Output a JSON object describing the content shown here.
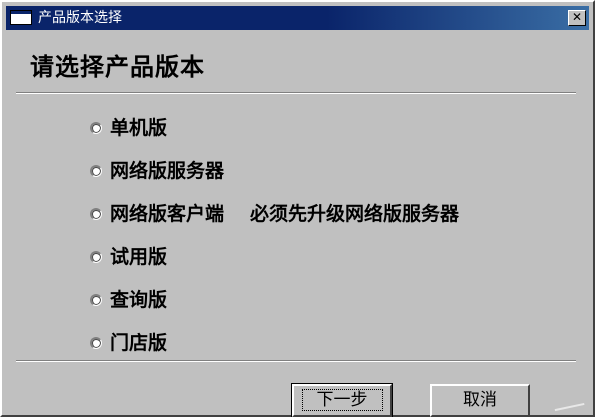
{
  "window": {
    "title": "产品版本选择",
    "close_label": "✕"
  },
  "heading": "请选择产品版本",
  "options": [
    {
      "label": "单机版",
      "selected": false
    },
    {
      "label": "网络版服务器",
      "selected": false
    },
    {
      "label": "网络版客户端",
      "note": "必须先升级网络版服务器",
      "selected": false
    },
    {
      "label": "试用版",
      "selected": false
    },
    {
      "label": "查询版",
      "selected": false
    },
    {
      "label": "门店版",
      "selected": false
    }
  ],
  "buttons": {
    "next_label": "下一步",
    "cancel_label": "取消"
  },
  "colors": {
    "titlebar": "#0a246a",
    "face": "#c0c0c0"
  }
}
